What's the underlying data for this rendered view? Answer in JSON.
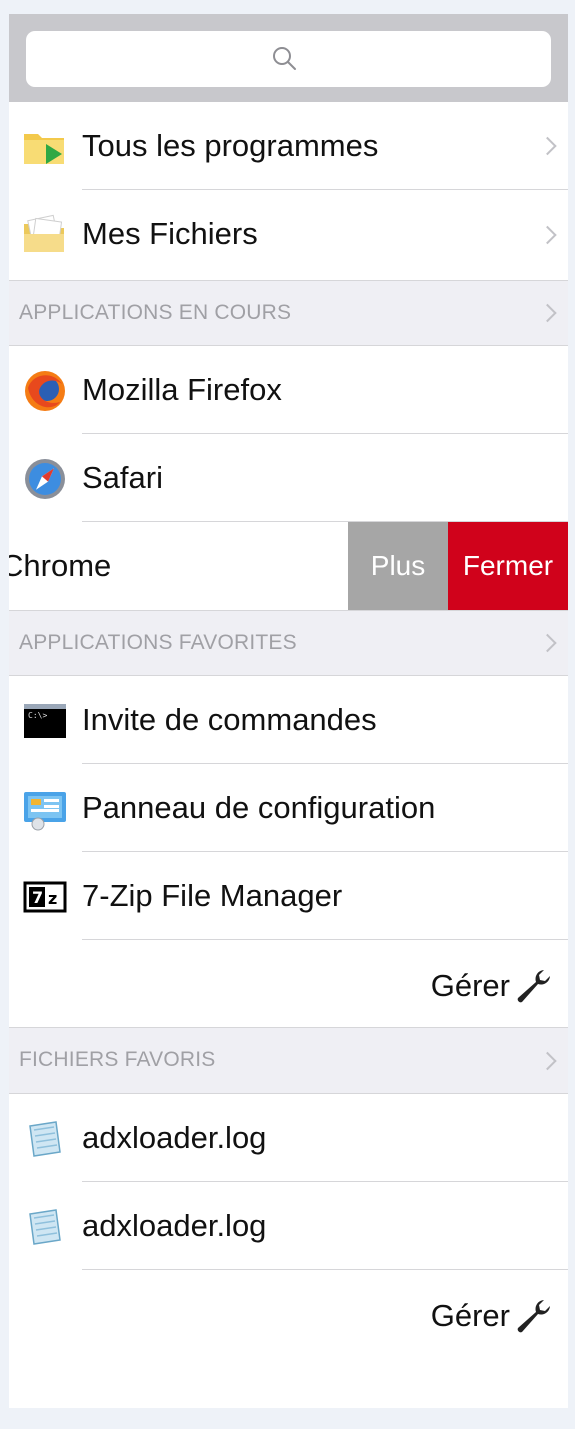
{
  "search": {
    "icon": "search-icon"
  },
  "top_items": [
    {
      "label": "Tous les programmes",
      "icon": "folder-play-icon"
    },
    {
      "label": "Mes Fichiers",
      "icon": "folder-documents-icon"
    }
  ],
  "running": {
    "title": "APPLICATIONS EN COURS",
    "items": [
      {
        "label": "Mozilla Firefox",
        "icon": "firefox-icon"
      },
      {
        "label": "Safari",
        "icon": "safari-icon"
      }
    ],
    "swiped_item": {
      "label": "Chrome",
      "more_label": "Plus",
      "close_label": "Fermer"
    }
  },
  "favorites": {
    "title": "APPLICATIONS FAVORITES",
    "items": [
      {
        "label": "Invite de commandes",
        "icon": "terminal-icon"
      },
      {
        "label": "Panneau de configuration",
        "icon": "control-panel-icon"
      },
      {
        "label": "7-Zip File Manager",
        "icon": "7zip-icon"
      }
    ],
    "manage_label": "Gérer"
  },
  "files": {
    "title": "FICHIERS FAVORIS",
    "items": [
      {
        "label": "adxloader.log",
        "icon": "log-file-icon"
      },
      {
        "label": "adxloader.log",
        "icon": "log-file-icon"
      }
    ],
    "manage_label": "Gérer"
  },
  "colors": {
    "close_action": "#d0021b",
    "more_action": "#a6a6a6",
    "section_bg": "#efeff4",
    "section_text": "#a0a0a5"
  }
}
